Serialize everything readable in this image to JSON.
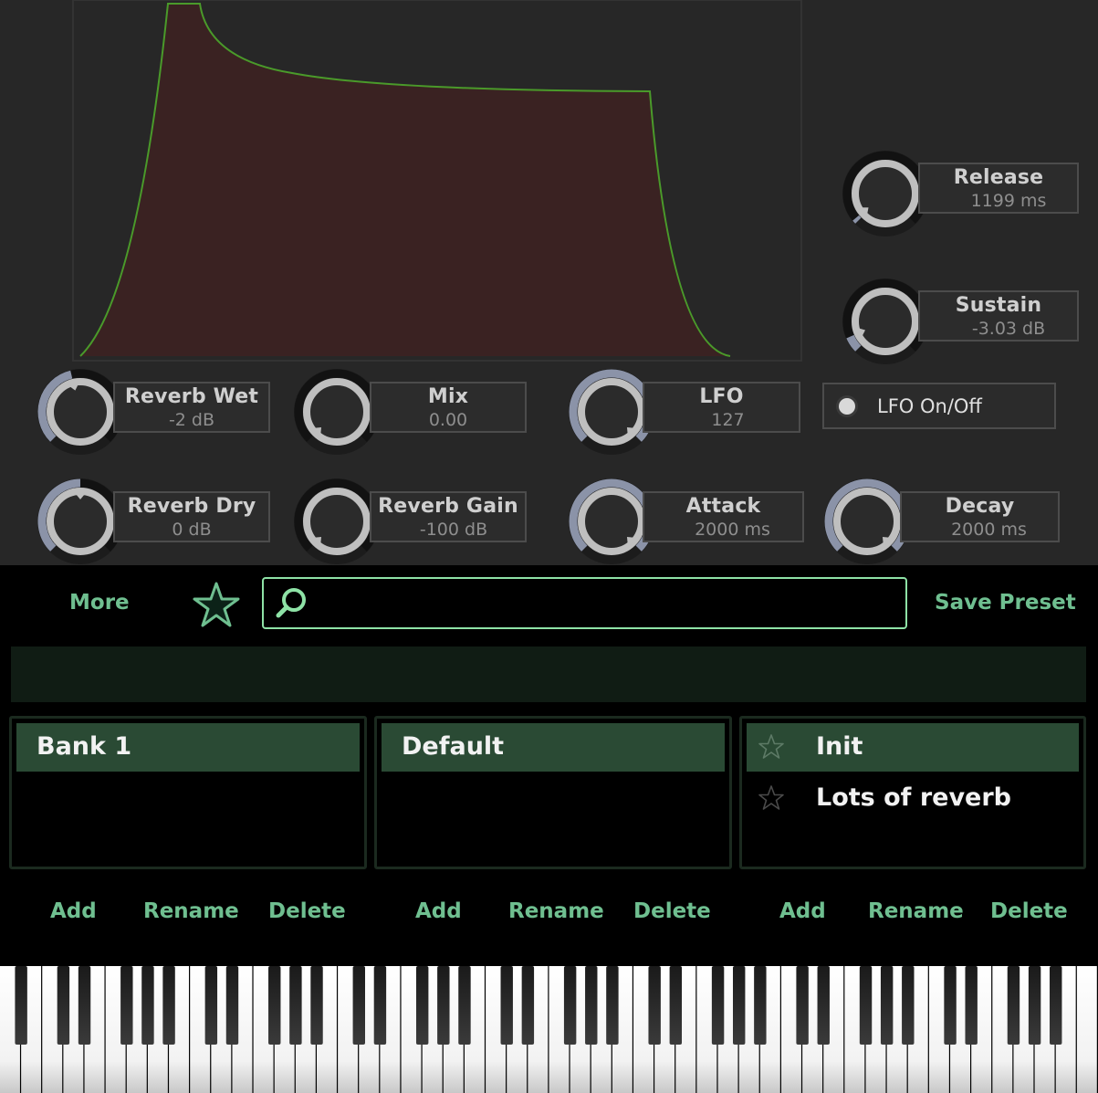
{
  "envelope": {
    "fill_color": "#3a2222",
    "line_color": "#4a9a2a"
  },
  "knobs": {
    "release": {
      "label": "Release",
      "value": "1199 ms",
      "fraction": 0.02
    },
    "sustain": {
      "label": "Sustain",
      "value": "-3.03 dB",
      "fraction": 0.08
    },
    "reverb_wet": {
      "label": "Reverb Wet",
      "value": "-2 dB",
      "fraction": 0.45
    },
    "mix": {
      "label": "Mix",
      "value": "0.00",
      "fraction": 0.0
    },
    "lfo": {
      "label": "LFO",
      "value": "127",
      "fraction": 1.0
    },
    "reverb_dry": {
      "label": "Reverb Dry",
      "value": "0 dB",
      "fraction": 0.5
    },
    "reverb_gain": {
      "label": "Reverb Gain",
      "value": "-100 dB",
      "fraction": 0.0
    },
    "attack": {
      "label": "Attack",
      "value": "2000 ms",
      "fraction": 1.0
    },
    "decay": {
      "label": "Decay",
      "value": "2000 ms",
      "fraction": 1.0
    }
  },
  "lfo_toggle": {
    "label": "LFO On/Off"
  },
  "browser": {
    "more_label": "More",
    "save_label": "Save Preset",
    "search_value": "",
    "banks": [
      "Bank 1"
    ],
    "folders": [
      "Default"
    ],
    "presets": [
      "Init",
      "Lots of reverb"
    ],
    "actions": {
      "add": "Add",
      "rename": "Rename",
      "delete": "Delete"
    },
    "accent": "#6fbf90"
  },
  "keyboard": {
    "white_keys": 52
  }
}
